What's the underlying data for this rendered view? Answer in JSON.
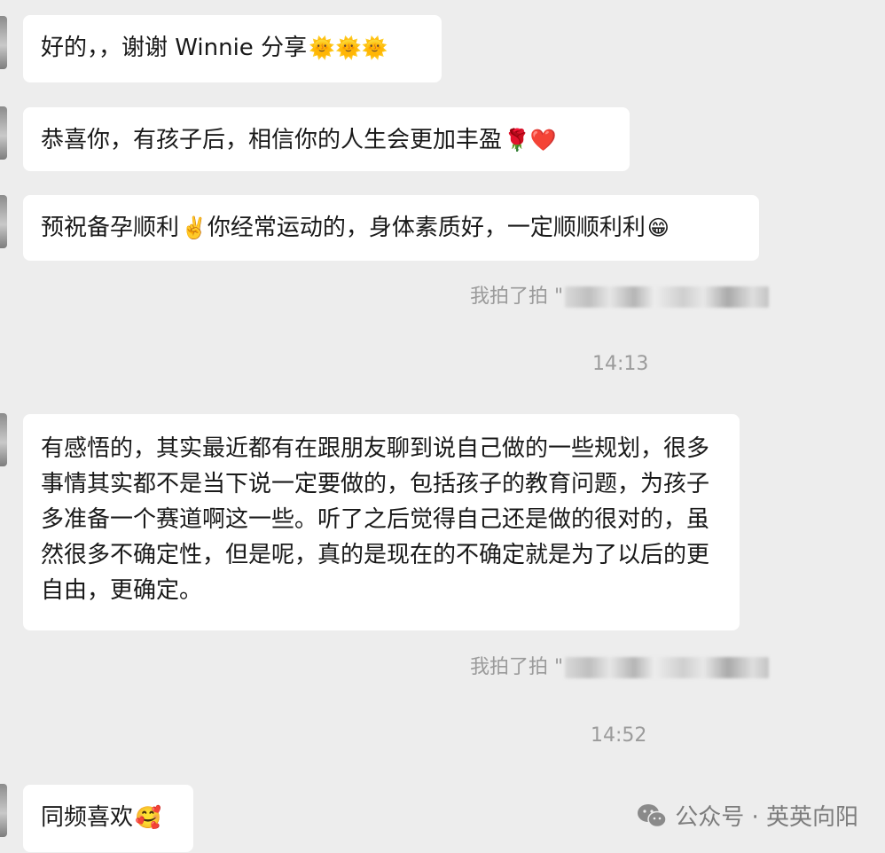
{
  "messages": [
    {
      "text": "好的，，谢谢 Winnie 分享",
      "emoji": "🌞🌞🌞"
    },
    {
      "text": "恭喜你，有孩子后，相信你的人生会更加丰盈",
      "emoji": "🌹❤️"
    },
    {
      "text_before": "预祝备孕顺利",
      "emoji_mid": "✌️",
      "text_after": "你经常运动的，身体素质好，一定顺顺利利",
      "emoji": "😁"
    },
    {
      "text": "有感悟的，其实最近都有在跟朋友聊到说自己做的一些规划，很多事情其实都不是当下说一定要做的，包括孩子的教育问题，为孩子多准备一个赛道啊这一些。听了之后觉得自己还是做的很对的，虽然很多不确定性，但是呢，真的是现在的不确定就是为了以后的更自由，更确定。"
    },
    {
      "text": "同频喜欢",
      "emoji": "🥰"
    }
  ],
  "pats": [
    {
      "prefix": "我拍了拍 \""
    },
    {
      "prefix": "我拍了拍 \""
    }
  ],
  "timestamps": [
    "14:13",
    "14:52"
  ],
  "watermark": {
    "label": "公众号 · 英英向阳",
    "icon": "wechat-icon"
  }
}
